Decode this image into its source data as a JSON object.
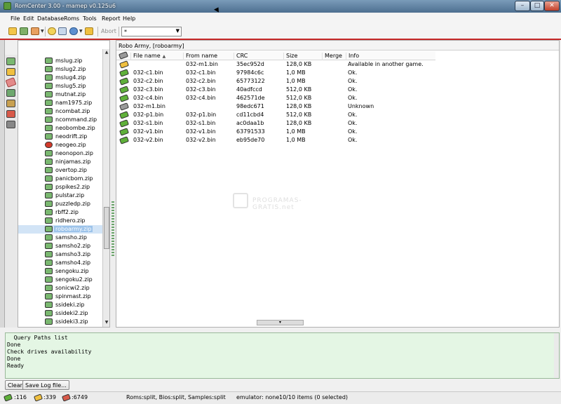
{
  "window": {
    "title": "RomCenter 3.00 - mamep v0.125u6"
  },
  "menu": [
    "File",
    "Edit",
    "Database",
    "Roms",
    "Tools",
    "Report",
    "Help"
  ],
  "toolbar": {
    "abort_label": "Abort",
    "filter_value": "*"
  },
  "tree": {
    "selected": "roboarmy.zip",
    "items": [
      {
        "name": "mslug.zip",
        "icon": "zip-icon"
      },
      {
        "name": "mslug2.zip",
        "icon": "zip-icon"
      },
      {
        "name": "mslug4.zip",
        "icon": "zip-icon"
      },
      {
        "name": "mslug5.zip",
        "icon": "zip-icon"
      },
      {
        "name": "mutnat.zip",
        "icon": "zip-icon"
      },
      {
        "name": "nam1975.zip",
        "icon": "zip-icon"
      },
      {
        "name": "ncombat.zip",
        "icon": "zip-icon"
      },
      {
        "name": "ncommand.zip",
        "icon": "zip-icon"
      },
      {
        "name": "neobombe.zip",
        "icon": "zip-icon"
      },
      {
        "name": "neodrift.zip",
        "icon": "zip-icon"
      },
      {
        "name": "neogeo.zip",
        "icon": "error-icon"
      },
      {
        "name": "neonopon.zip",
        "icon": "zip-icon"
      },
      {
        "name": "ninjamas.zip",
        "icon": "zip-icon"
      },
      {
        "name": "overtop.zip",
        "icon": "zip-icon"
      },
      {
        "name": "panicbom.zip",
        "icon": "zip-icon"
      },
      {
        "name": "pspikes2.zip",
        "icon": "zip-icon"
      },
      {
        "name": "pulstar.zip",
        "icon": "zip-icon"
      },
      {
        "name": "puzzledp.zip",
        "icon": "zip-icon"
      },
      {
        "name": "rbff2.zip",
        "icon": "zip-icon"
      },
      {
        "name": "ridhero.zip",
        "icon": "zip-icon"
      },
      {
        "name": "roboarmy.zip",
        "icon": "zip-icon"
      },
      {
        "name": "samsho.zip",
        "icon": "zip-icon"
      },
      {
        "name": "samsho2.zip",
        "icon": "zip-icon"
      },
      {
        "name": "samsho3.zip",
        "icon": "zip-icon"
      },
      {
        "name": "samsho4.zip",
        "icon": "zip-icon"
      },
      {
        "name": "sengoku.zip",
        "icon": "zip-icon"
      },
      {
        "name": "sengoku2.zip",
        "icon": "zip-icon"
      },
      {
        "name": "sonicwi2.zip",
        "icon": "zip-icon"
      },
      {
        "name": "spinmast.zip",
        "icon": "zip-icon"
      },
      {
        "name": "ssideki.zip",
        "icon": "zip-icon"
      },
      {
        "name": "ssideki2.zip",
        "icon": "zip-icon"
      },
      {
        "name": "ssideki3.zip",
        "icon": "zip-icon"
      }
    ]
  },
  "detail": {
    "title": "Robo Army, [roboarmy]",
    "columns": [
      "File name",
      "From name",
      "CRC",
      "Size",
      "Merge",
      "Info"
    ],
    "rows": [
      {
        "status": "warn",
        "file": "",
        "from": "032-m1.bin",
        "crc": "35ec952d",
        "size": "128,0 KB",
        "merge": "",
        "info": "Available in another game."
      },
      {
        "status": "ok",
        "file": "032-c1.bin",
        "from": "032-c1.bin",
        "crc": "97984c6c",
        "size": "1,0 MB",
        "merge": "",
        "info": "Ok."
      },
      {
        "status": "ok",
        "file": "032-c2.bin",
        "from": "032-c2.bin",
        "crc": "65773122",
        "size": "1,0 MB",
        "merge": "",
        "info": "Ok."
      },
      {
        "status": "ok",
        "file": "032-c3.bin",
        "from": "032-c3.bin",
        "crc": "40adfccd",
        "size": "512,0 KB",
        "merge": "",
        "info": "Ok."
      },
      {
        "status": "ok",
        "file": "032-c4.bin",
        "from": "032-c4.bin",
        "crc": "462571de",
        "size": "512,0 KB",
        "merge": "",
        "info": "Ok."
      },
      {
        "status": "unknown",
        "file": "032-m1.bin",
        "from": "",
        "crc": "98edc671",
        "size": "128,0 KB",
        "merge": "",
        "info": "Unknown"
      },
      {
        "status": "ok",
        "file": "032-p1.bin",
        "from": "032-p1.bin",
        "crc": "cd11cbd4",
        "size": "512,0 KB",
        "merge": "",
        "info": "Ok."
      },
      {
        "status": "ok",
        "file": "032-s1.bin",
        "from": "032-s1.bin",
        "crc": "ac0daa1b",
        "size": "128,0 KB",
        "merge": "",
        "info": "Ok."
      },
      {
        "status": "ok",
        "file": "032-v1.bin",
        "from": "032-v1.bin",
        "crc": "63791533",
        "size": "1,0 MB",
        "merge": "",
        "info": "Ok."
      },
      {
        "status": "ok",
        "file": "032-v2.bin",
        "from": "032-v2.bin",
        "crc": "eb95de70",
        "size": "1,0 MB",
        "merge": "",
        "info": "Ok."
      }
    ]
  },
  "watermark": "PROGRAMAS-GRATIS.net",
  "log": {
    "lines": [
      "  Query Paths list",
      "Done",
      "Check drives availability",
      "Done",
      "Ready"
    ],
    "clear_label": "Clear",
    "save_label": "Save Log file..."
  },
  "status": {
    "count_ok": ":116",
    "count_warn": ":339",
    "count_bad": ":6749",
    "settings": "Roms:split, Bios:split, Samples:split",
    "emulator": "emulator: none",
    "items": "10/10 items (0 selected)"
  },
  "colors": {
    "accent_red": "#c62828",
    "log_bg": "#e4f6e4",
    "selection": "#9cc3ea"
  }
}
